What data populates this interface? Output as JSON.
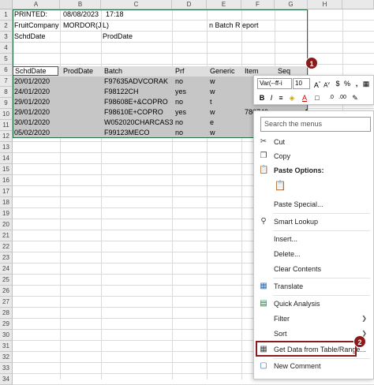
{
  "columns": [
    "A",
    "B",
    "C",
    "D",
    "E",
    "F",
    "G",
    "H"
  ],
  "rows": [
    "1",
    "2",
    "3",
    "4",
    "5",
    "6",
    "7",
    "8",
    "9",
    "10",
    "11",
    "12",
    "13",
    "14",
    "15",
    "16",
    "17",
    "18",
    "19",
    "20",
    "21",
    "22",
    "23",
    "24",
    "25",
    "26",
    "27",
    "28",
    "29",
    "30",
    "31",
    "32",
    "33",
    "34"
  ],
  "cells": {
    "r1": {
      "a": "PRINTED:",
      "b": "08/08/2023",
      "c": "17:18"
    },
    "r2": {
      "a": "FruitCompany",
      "b": "MORDOR(J",
      "c": "L)",
      "e": "n Batch R",
      "f": "eport"
    },
    "r3": {
      "a": "SchdDate",
      "c": "ProdDate"
    }
  },
  "table": {
    "headers": [
      "SchdDate",
      "ProdDate",
      "Batch",
      "Prf",
      "Generic",
      "Item",
      "Seq"
    ],
    "rows": [
      {
        "schd": "20/01/2020",
        "batch": "F97635ADVCORAK",
        "prf": "no",
        "generic": "w",
        "item": ""
      },
      {
        "schd": "24/01/2020",
        "batch": "F98122CH",
        "prf": "yes",
        "generic": "w",
        "item": ""
      },
      {
        "schd": "29/01/2020",
        "batch": "F98608E+&COPRO",
        "prf": "no",
        "generic": "t",
        "item": ""
      },
      {
        "schd": "29/01/2020",
        "batch": "F98610E+COPRO",
        "prf": "yes",
        "generic": "w",
        "item": "786749"
      },
      {
        "schd": "30/01/2020",
        "batch": "W052020CHARCAS3",
        "prf": "no",
        "generic": "e",
        "item": ""
      },
      {
        "schd": "05/02/2020",
        "batch": "F99123MECO",
        "prf": "no",
        "generic": "w",
        "item": ""
      }
    ],
    "partial_seq": "1"
  },
  "minibar": {
    "font": "Var(--ff-i",
    "size": "10",
    "icons": [
      "increase-font-icon",
      "decrease-font-icon",
      "currency-icon",
      "percent-icon",
      "comma-icon",
      "table-icon",
      "bold-icon",
      "italic-icon",
      "align-icon",
      "fill-color-icon",
      "font-color-icon",
      "borders-icon",
      "decrease-decimal-icon",
      "increase-decimal-icon",
      "format-painter-icon"
    ]
  },
  "menu": {
    "search_placeholder": "Search the menus",
    "cut": "Cut",
    "copy": "Copy",
    "paste_options": "Paste Options:",
    "paste_special": "Paste Special...",
    "smart_lookup": "Smart Lookup",
    "insert": "Insert...",
    "delete": "Delete...",
    "clear_contents": "Clear Contents",
    "translate": "Translate",
    "quick_analysis": "Quick Analysis",
    "filter": "Filter",
    "sort": "Sort",
    "get_data": "Get Data from Table/Range...",
    "new_comment": "New Comment"
  },
  "badges": {
    "one": "1",
    "two": "2"
  },
  "colors": {
    "accent": "#217346",
    "badge": "#8b1a1a",
    "selection": "#c6c6c6"
  }
}
